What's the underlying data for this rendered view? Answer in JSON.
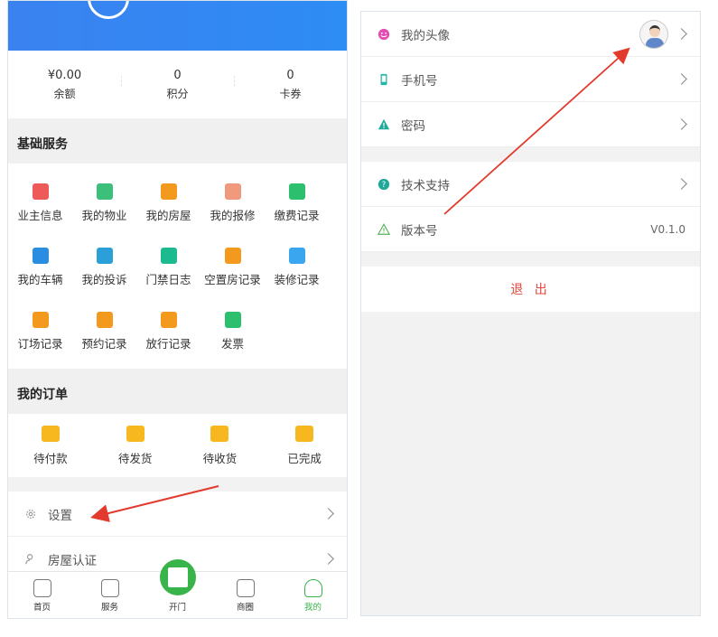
{
  "stats": [
    {
      "value": "¥0.00",
      "label": "余额"
    },
    {
      "value": "0",
      "label": "积分"
    },
    {
      "value": "0",
      "label": "卡券"
    }
  ],
  "basic_services": {
    "title": "基础服务",
    "items": [
      {
        "label": "业主信息",
        "icon": "owner-info-icon",
        "color": "#ee5a5a"
      },
      {
        "label": "我的物业",
        "icon": "building-icon",
        "color": "#3bbf7a"
      },
      {
        "label": "我的房屋",
        "icon": "house-icon",
        "color": "#f39a1e"
      },
      {
        "label": "我的报修",
        "icon": "repair-icon",
        "color": "#f09a7d"
      },
      {
        "label": "缴费记录",
        "icon": "payment-record-icon",
        "color": "#2cbf6e"
      },
      {
        "label": "我的车辆",
        "icon": "parking-icon",
        "color": "#2a8de0"
      },
      {
        "label": "我的投诉",
        "icon": "complaint-icon",
        "color": "#2a9fd8"
      },
      {
        "label": "门禁日志",
        "icon": "access-log-icon",
        "color": "#1cba8e"
      },
      {
        "label": "空置房记录",
        "icon": "vacant-room-icon",
        "color": "#f39a1e"
      },
      {
        "label": "装修记录",
        "icon": "renovation-icon",
        "color": "#3aa6f0"
      },
      {
        "label": "订场记录",
        "icon": "booking-venue-icon",
        "color": "#f39a1e"
      },
      {
        "label": "预约记录",
        "icon": "appointment-icon",
        "color": "#f39a1e"
      },
      {
        "label": "放行记录",
        "icon": "release-icon",
        "color": "#f39a1e"
      },
      {
        "label": "发票",
        "icon": "invoice-icon",
        "color": "#2cbf6e"
      }
    ]
  },
  "orders": {
    "title": "我的订单",
    "items": [
      {
        "label": "待付款",
        "icon": "wallet-icon"
      },
      {
        "label": "待发货",
        "icon": "package-icon"
      },
      {
        "label": "待收货",
        "icon": "truck-icon"
      },
      {
        "label": "已完成",
        "icon": "completed-icon"
      }
    ]
  },
  "left_menu": [
    {
      "label": "设置",
      "icon": "gear-icon"
    },
    {
      "label": "房屋认证",
      "icon": "user-verify-icon"
    }
  ],
  "tabbar": [
    {
      "label": "首页",
      "icon": "home-icon"
    },
    {
      "label": "服务",
      "icon": "service-icon"
    },
    {
      "label": "开门",
      "icon": "qr-code-icon"
    },
    {
      "label": "商圈",
      "icon": "shop-icon"
    },
    {
      "label": "我的",
      "icon": "profile-icon",
      "active": true
    }
  ],
  "settings": {
    "avatar_label": "我的头像",
    "phone_label": "手机号",
    "password_label": "密码",
    "support_label": "技术支持",
    "version_label": "版本号",
    "version_value": "V0.1.0",
    "logout_label": "退 出"
  },
  "colors": {
    "brand_green": "#39b44a",
    "banner_blue": "#3a82f0",
    "logout_red": "#e0483c",
    "arrow_red": "#e23a2c"
  }
}
